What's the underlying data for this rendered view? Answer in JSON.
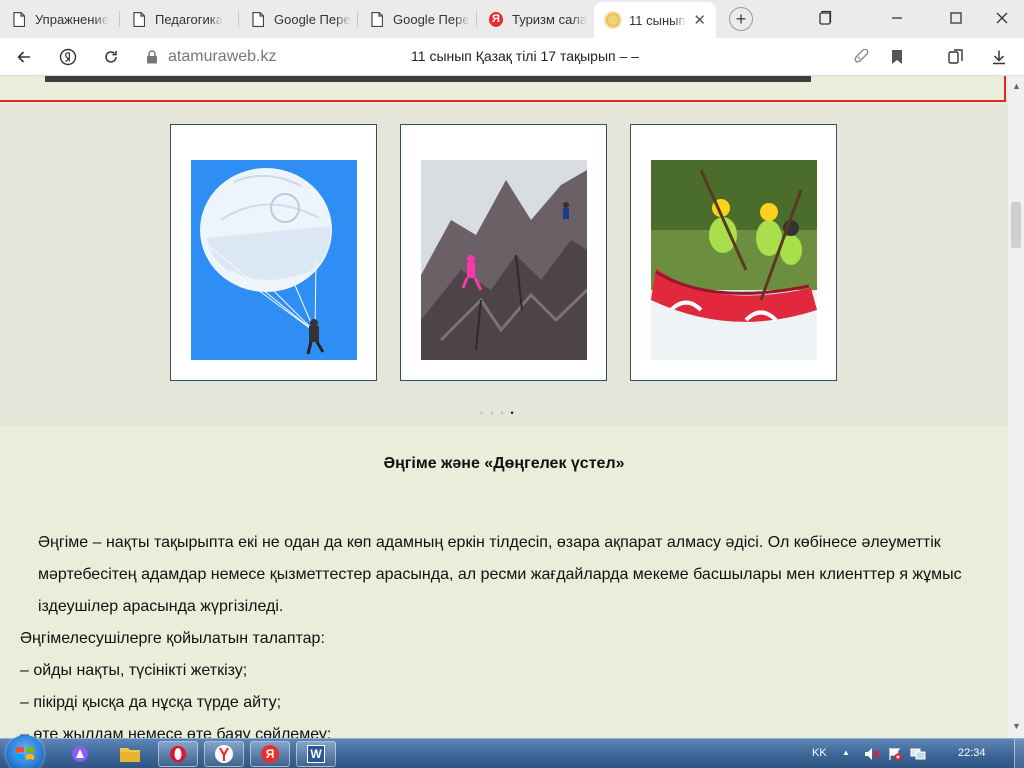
{
  "tabs": [
    {
      "title": "Упражнение",
      "icon": "page-icon"
    },
    {
      "title": "Педагогика",
      "icon": "page-icon"
    },
    {
      "title": "Google Пере",
      "icon": "page-icon"
    },
    {
      "title": "Google Пере",
      "icon": "page-icon"
    },
    {
      "title": "Туризм сала",
      "icon": "yandex-icon"
    },
    {
      "title": "11 сынып",
      "icon": "sun-icon",
      "active": true
    }
  ],
  "yandex_letter": "Я",
  "address": {
    "domain": "atamuraweb.kz",
    "page_title": "11 сынып Қазақ тілі 17 тақырып – –"
  },
  "carousel": {
    "images": [
      {
        "alt": "parachutist"
      },
      {
        "alt": "rock-climbers"
      },
      {
        "alt": "rafting"
      }
    ],
    "dots": 4,
    "active_dot": 4
  },
  "article": {
    "heading": "Әңгіме және «Дөңгелек үстел»",
    "paragraph": "Әңгіме – нақты тақырыпта екі не одан да көп адамның еркін тілдесіп, өзара ақпарат алмасу әдісі. Ол көбінесе әлеуметтік мәртебесітең адамдар немесе қызметтестер арасында, ал ресми жағдайларда мекеме басшылары мен клиенттер я жұмыс іздеушілер арасында жүргізіледі.",
    "requirements_title": "Әңгімелесушілерге қойылатын талаптар:",
    "requirements": [
      "– ойды нақты, түсінікті жеткізу;",
      "– пікірді қысқа да нұсқа түрде айту;",
      "– өте жылдам немесе өте баяу сөйлемеу;"
    ]
  },
  "taskbar": {
    "language": "KK",
    "time": "22:34",
    "apps": [
      "alice",
      "explorer",
      "opera",
      "yandex-browser",
      "yandex",
      "word"
    ],
    "word_letter": "W"
  },
  "colors": {
    "page_bg": "#e9eedb",
    "carousel_bg": "#e3e6d9",
    "accent_red": "#e62424",
    "card_border": "#2f5454"
  }
}
